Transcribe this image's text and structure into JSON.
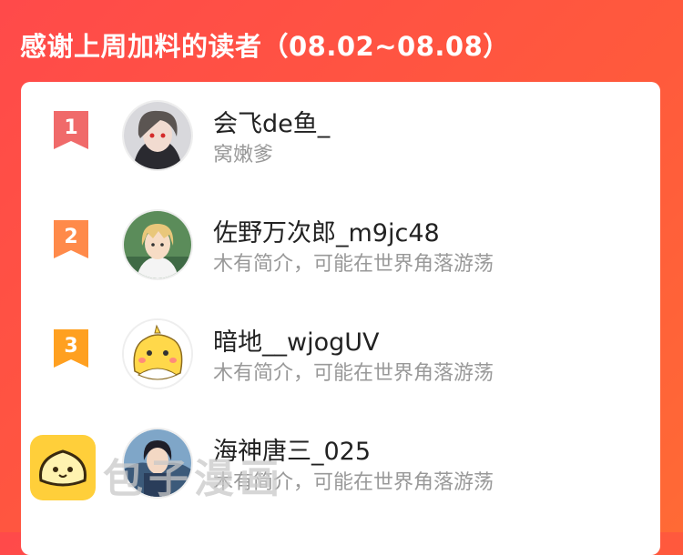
{
  "header": {
    "title": "感谢上周加料的读者（08.02~08.08）"
  },
  "readers": [
    {
      "rank": "1",
      "name": "会飞de鱼_",
      "bio": "窝嫩爹",
      "rank_color": "#f06a6a",
      "avatar": "avatar-dark-hair-red-eyes"
    },
    {
      "rank": "2",
      "name": "佐野万次郎_m9jc48",
      "bio": "木有简介，可能在世界角落游荡",
      "rank_color": "#ff8a4a",
      "avatar": "avatar-blond-boy"
    },
    {
      "rank": "3",
      "name": "暗地__wjogUV",
      "bio": "木有简介，可能在世界角落游荡",
      "rank_color": "#ffa020",
      "avatar": "avatar-yellow-cartoon-pet"
    },
    {
      "rank": "",
      "name": "海神唐三_025",
      "bio": "木有简介，可能在世界角落游荡",
      "rank_color": "",
      "avatar": "avatar-warrior"
    }
  ],
  "watermark": {
    "text": "包子漫画",
    "logo": "bun-logo-icon",
    "logo_color": "#ffcf3a"
  }
}
